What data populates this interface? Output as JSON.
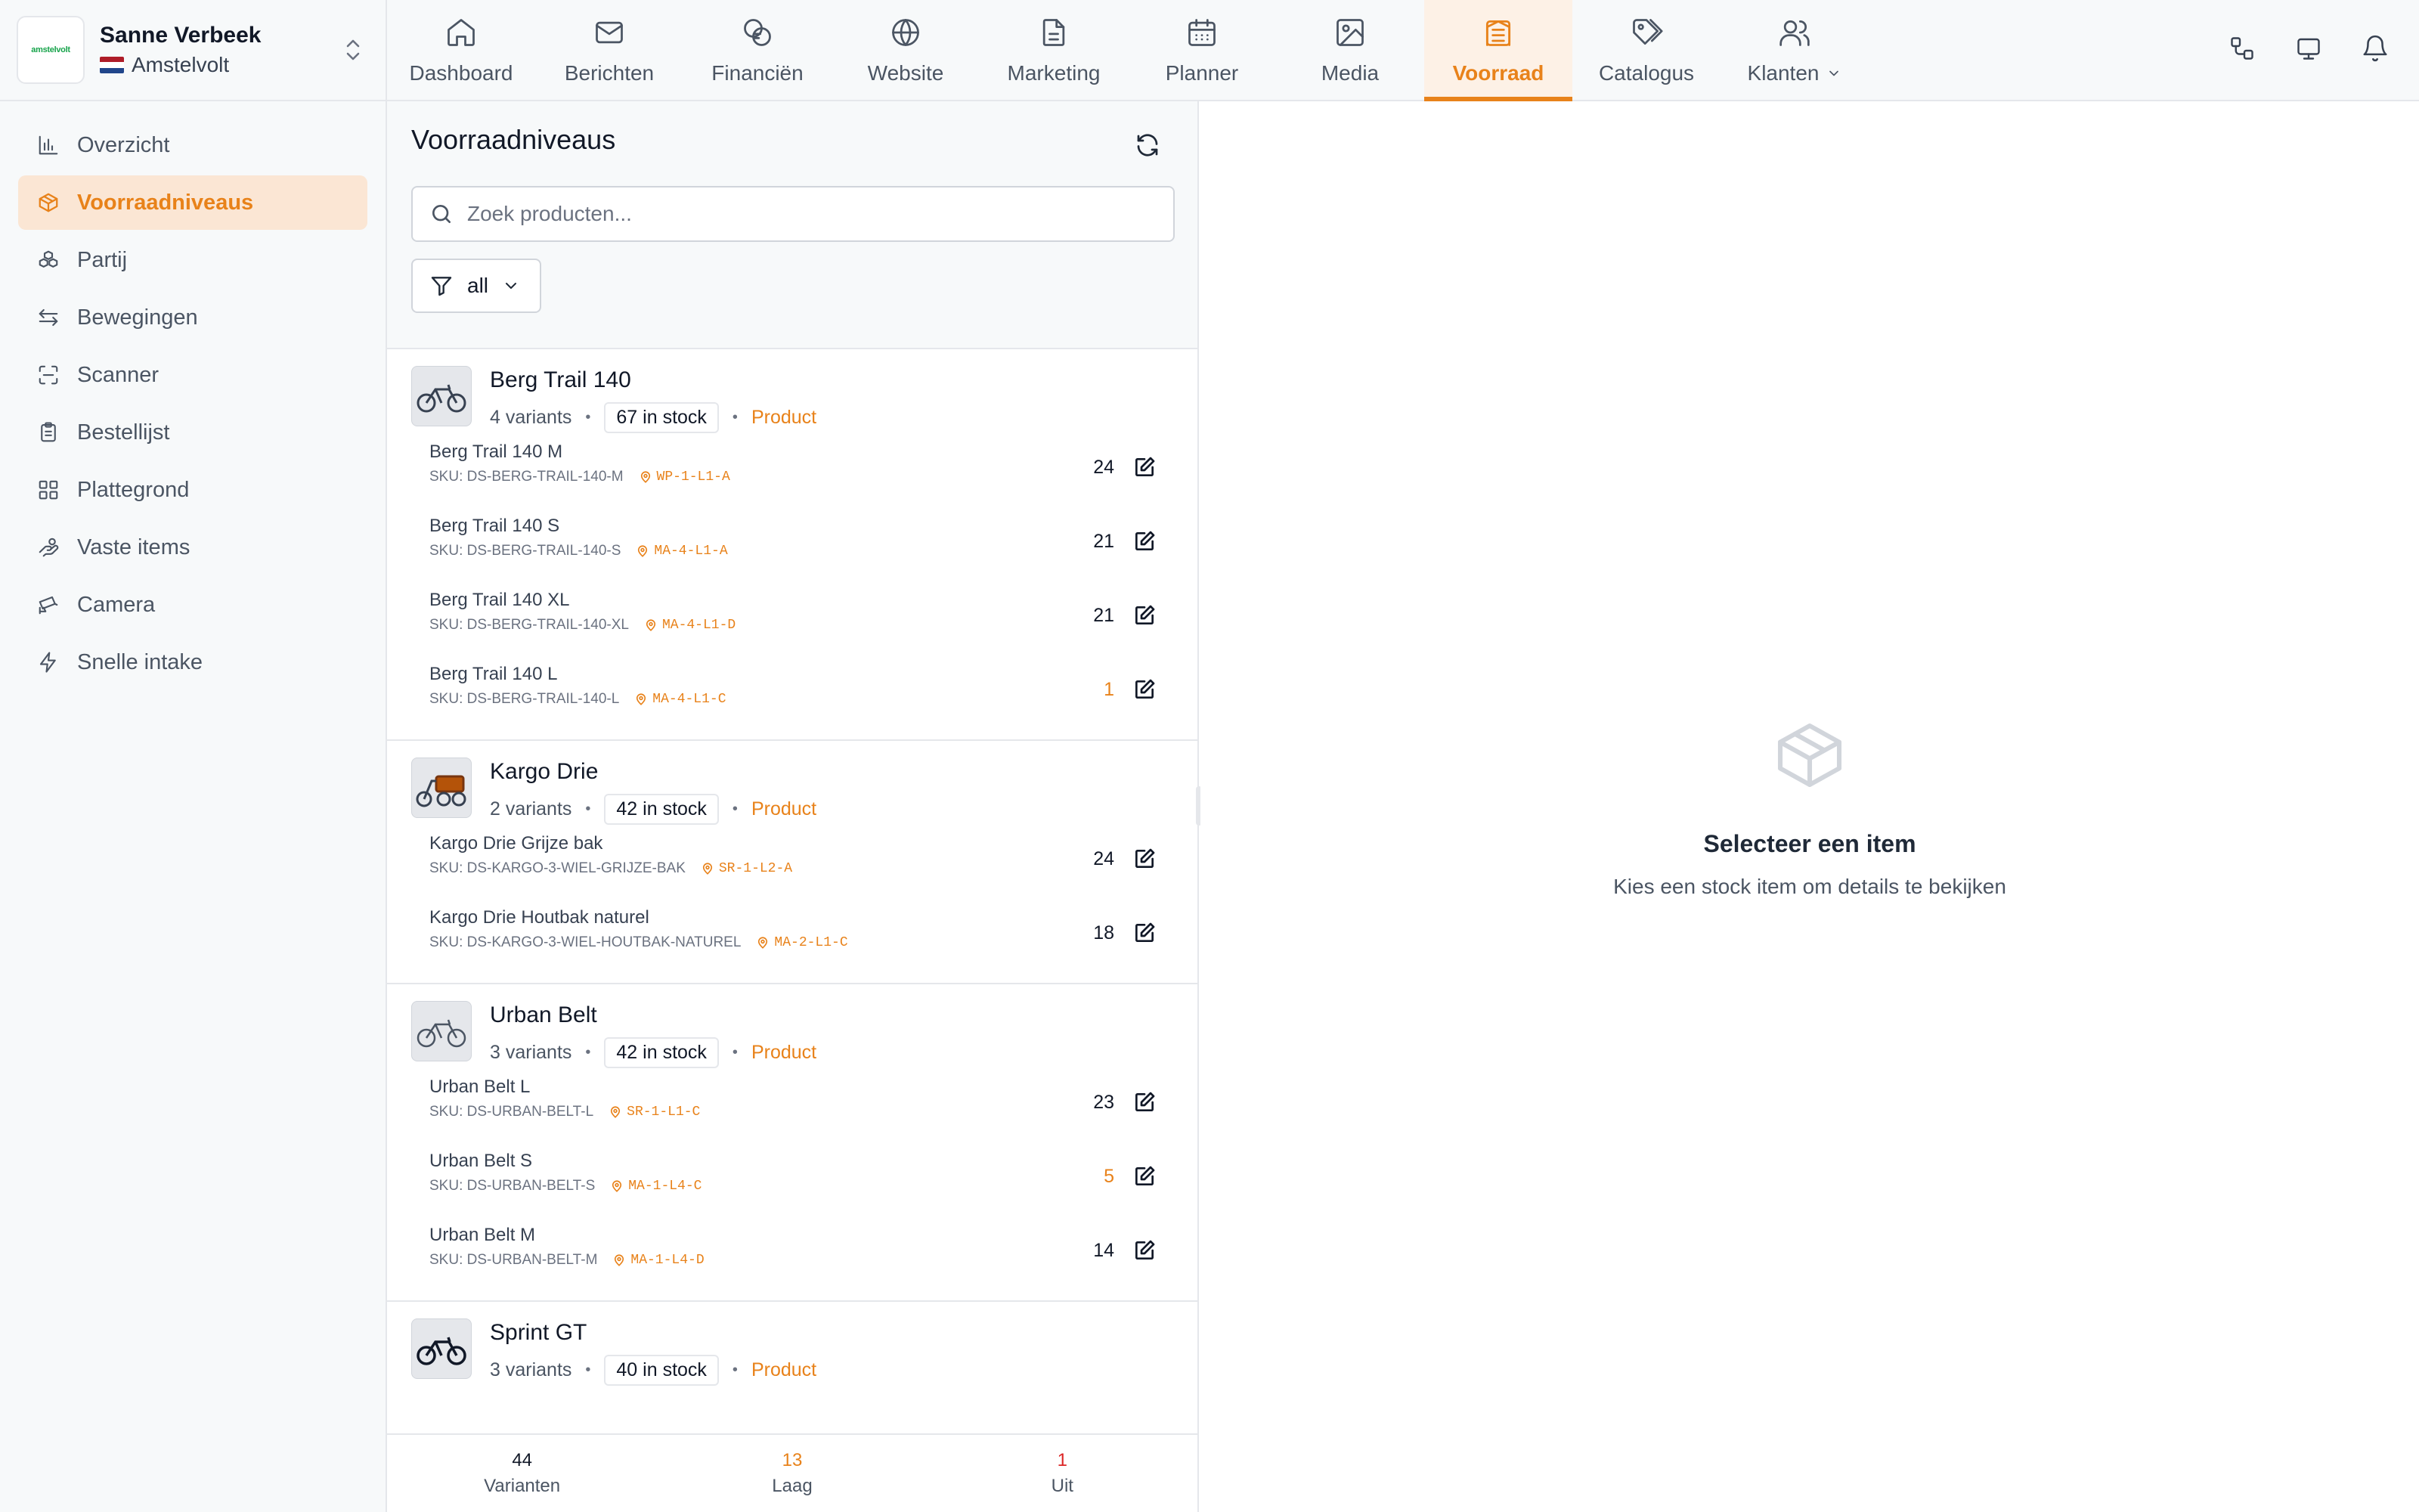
{
  "account": {
    "user": "Sanne Verbeek",
    "org": "Amstelvolt",
    "logo_text": "amstelvolt"
  },
  "nav": {
    "tabs": [
      {
        "label": "Dashboard",
        "icon": "home-icon"
      },
      {
        "label": "Berichten",
        "icon": "mail-icon"
      },
      {
        "label": "Financiën",
        "icon": "coins-icon"
      },
      {
        "label": "Website",
        "icon": "globe-icon"
      },
      {
        "label": "Marketing",
        "icon": "document-icon"
      },
      {
        "label": "Planner",
        "icon": "calendar-icon"
      },
      {
        "label": "Media",
        "icon": "image-icon"
      },
      {
        "label": "Voorraad",
        "icon": "warehouse-icon",
        "active": true
      },
      {
        "label": "Catalogus",
        "icon": "tags-icon"
      },
      {
        "label": "Klanten",
        "icon": "users-icon"
      }
    ]
  },
  "sidebar": {
    "items": [
      {
        "label": "Overzicht",
        "icon": "bar-chart-icon"
      },
      {
        "label": "Voorraadniveaus",
        "icon": "box-icon",
        "active": true
      },
      {
        "label": "Partij",
        "icon": "boxes-icon"
      },
      {
        "label": "Bewegingen",
        "icon": "arrows-exchange-icon"
      },
      {
        "label": "Scanner",
        "icon": "scan-icon"
      },
      {
        "label": "Bestellijst",
        "icon": "clipboard-icon"
      },
      {
        "label": "Plattegrond",
        "icon": "grid-icon"
      },
      {
        "label": "Vaste items",
        "icon": "hand-coins-icon"
      },
      {
        "label": "Camera",
        "icon": "cctv-icon"
      },
      {
        "label": "Snelle intake",
        "icon": "zap-icon"
      }
    ]
  },
  "panel": {
    "title": "Voorraadniveaus",
    "search_placeholder": "Zoek producten...",
    "filter_value": "all"
  },
  "products": [
    {
      "name": "Berg Trail 140",
      "variants_label": "4 variants",
      "stock_label": "67 in stock",
      "type": "Product",
      "variants": [
        {
          "name": "Berg Trail 140 M",
          "sku": "SKU: DS-BERG-TRAIL-140-M",
          "location": "WP-1-L1-A",
          "qty": "24",
          "low": false
        },
        {
          "name": "Berg Trail 140 S",
          "sku": "SKU: DS-BERG-TRAIL-140-S",
          "location": "MA-4-L1-A",
          "qty": "21",
          "low": false
        },
        {
          "name": "Berg Trail 140 XL",
          "sku": "SKU: DS-BERG-TRAIL-140-XL",
          "location": "MA-4-L1-D",
          "qty": "21",
          "low": false
        },
        {
          "name": "Berg Trail 140 L",
          "sku": "SKU: DS-BERG-TRAIL-140-L",
          "location": "MA-4-L1-C",
          "qty": "1",
          "low": true
        }
      ]
    },
    {
      "name": "Kargo Drie",
      "variants_label": "2 variants",
      "stock_label": "42 in stock",
      "type": "Product",
      "variants": [
        {
          "name": "Kargo Drie Grijze bak",
          "sku": "SKU: DS-KARGO-3-WIEL-GRIJZE-BAK",
          "location": "SR-1-L2-A",
          "qty": "24",
          "low": false
        },
        {
          "name": "Kargo Drie Houtbak naturel",
          "sku": "SKU: DS-KARGO-3-WIEL-HOUTBAK-NATUREL",
          "location": "MA-2-L1-C",
          "qty": "18",
          "low": false
        }
      ]
    },
    {
      "name": "Urban Belt",
      "variants_label": "3 variants",
      "stock_label": "42 in stock",
      "type": "Product",
      "variants": [
        {
          "name": "Urban Belt L",
          "sku": "SKU: DS-URBAN-BELT-L",
          "location": "SR-1-L1-C",
          "qty": "23",
          "low": false
        },
        {
          "name": "Urban Belt S",
          "sku": "SKU: DS-URBAN-BELT-S",
          "location": "MA-1-L4-C",
          "qty": "5",
          "low": true
        },
        {
          "name": "Urban Belt M",
          "sku": "SKU: DS-URBAN-BELT-M",
          "location": "MA-1-L4-D",
          "qty": "14",
          "low": false
        }
      ]
    },
    {
      "name": "Sprint GT",
      "variants_label": "3 variants",
      "stock_label": "40 in stock",
      "type": "Product",
      "variants": []
    }
  ],
  "footer": {
    "variants_value": "44",
    "variants_label": "Varianten",
    "low_value": "13",
    "low_label": "Laag",
    "out_value": "1",
    "out_label": "Uit"
  },
  "detail": {
    "empty_title": "Selecteer een item",
    "empty_subtitle": "Kies een stock item om details te bekijken"
  },
  "colors": {
    "accent": "#e8821a",
    "danger": "#dc2626"
  }
}
